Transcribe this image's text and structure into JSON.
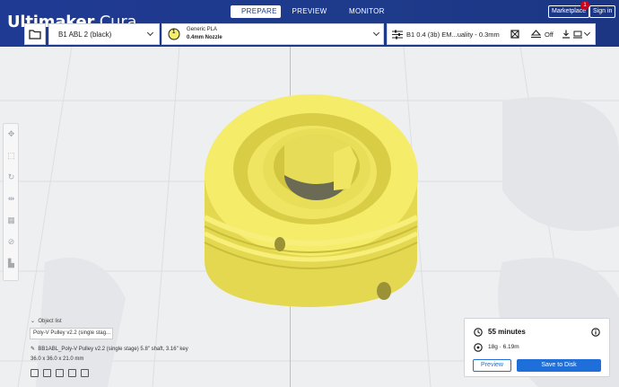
{
  "app": {
    "logo_bold": "Ultimaker",
    "logo_light": "Cura"
  },
  "tabs": [
    {
      "label": "PREPARE"
    },
    {
      "label": "PREVIEW"
    },
    {
      "label": "MONITOR"
    }
  ],
  "header": {
    "marketplace_label": "Marketplace",
    "marketplace_badge": "1",
    "signin_label": "Sign in"
  },
  "toolbar": {
    "printer_name": "B1 ABL 2 (black)",
    "extruder_number": "1",
    "material_name": "Generic PLA",
    "nozzle": "0.4mm Nozzle",
    "print_profile": "B1 0.4 (3b) EM...uality - 0.3mm",
    "support_state": "Off"
  },
  "object": {
    "list_label": "Object list",
    "name": "Poly-V Pulley v2.2 (single stag...",
    "file_label": "BB1ABL_Poly-V Pulley v2.2 (single stage) 5.8\" shaft, 3.16\" key",
    "dimensions": "36.0 x 36.0 x 21.0 mm"
  },
  "print": {
    "time": "55 minutes",
    "material_usage": "18g · 6.19m",
    "preview_label": "Preview",
    "save_label": "Save to Disk"
  },
  "colors": {
    "header_blue": "#1e3a8a",
    "accent_blue": "#1e6fd9",
    "model_yellow": "#f5ec6a"
  },
  "icons": [
    "folder-icon",
    "extruder-badge-icon",
    "settings-sliders-icon",
    "support-icon",
    "adhesion-icon",
    "download-icon",
    "clock-icon",
    "info-icon",
    "spool-icon",
    "move-icon",
    "scale-icon",
    "rotate-icon",
    "mirror-icon",
    "per-model-settings-icon",
    "support-blocker-icon",
    "layer-icon"
  ]
}
